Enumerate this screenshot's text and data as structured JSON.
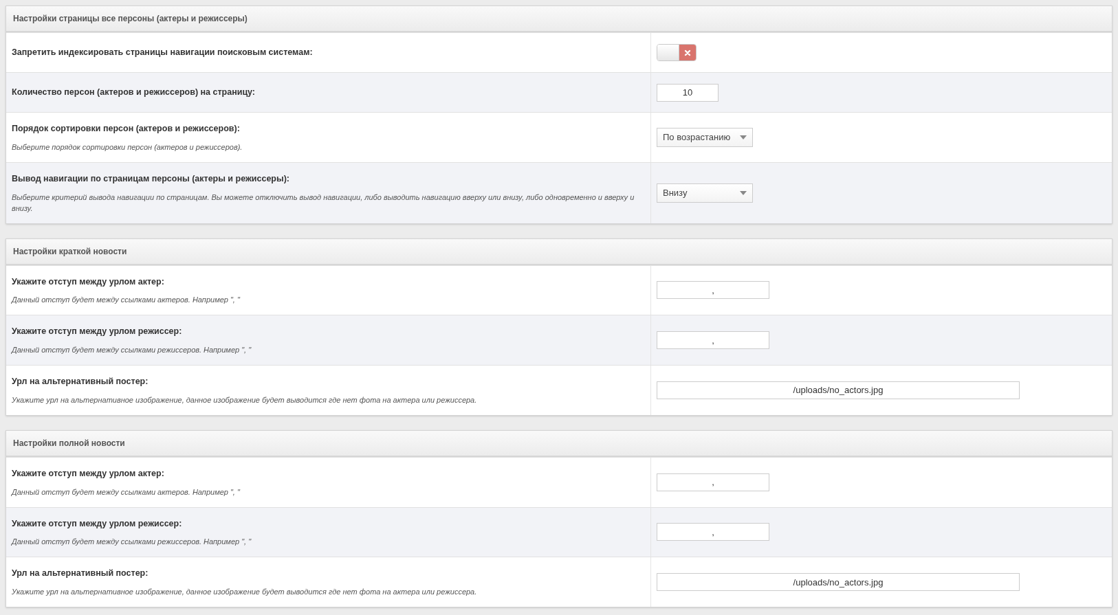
{
  "panels": [
    {
      "title": "Настройки страницы все персоны (актеры и режиссеры)",
      "rows": [
        {
          "kind": "toggle",
          "label": "Запретить индексировать страницы навигации поисковым системам:",
          "on": false
        },
        {
          "kind": "number",
          "label": "Количество персон (актеров и режиссеров) на страницу:",
          "value": "10"
        },
        {
          "kind": "select",
          "label": "Порядок сортировки персон (актеров и режиссеров):",
          "description": "Выберите порядок сортировки персон (актеров и режиссеров).",
          "value": "По возрастанию"
        },
        {
          "kind": "select",
          "label": "Вывод навигации по страницам персоны (актеры и режиссеры):",
          "description": "Выберите критерий вывода навигации по страницам. Вы можете отключить вывод навигации, либо выводить навигацию вверху или внизу, либо одновременно и вверху и внизу.",
          "value": "Внизу"
        }
      ]
    },
    {
      "title": "Настройки краткой новости",
      "rows": [
        {
          "kind": "text",
          "label": "Укажите отступ между урлом актер:",
          "description": "Данный отступ будет между ссылками актеров. Например \", \"",
          "value": ","
        },
        {
          "kind": "text",
          "label": "Укажите отступ между урлом режиссер:",
          "description": "Данный отступ будет между ссылками режиссеров. Например \", \"",
          "value": ","
        },
        {
          "kind": "url",
          "label": "Урл на альтернативный постер:",
          "description": "Укажите урл на альтернативное изображение, данное изображение будет выводится где нет фота на актера или режиссера.",
          "value": "/uploads/no_actors.jpg"
        }
      ]
    },
    {
      "title": "Настройки полной новости",
      "rows": [
        {
          "kind": "text",
          "label": "Укажите отступ между урлом актер:",
          "description": "Данный отступ будет между ссылками актеров. Например \", \"",
          "value": ","
        },
        {
          "kind": "text",
          "label": "Укажите отступ между урлом режиссер:",
          "description": "Данный отступ будет между ссылками режиссеров. Например \", \"",
          "value": ","
        },
        {
          "kind": "url",
          "label": "Урл на альтернативный постер:",
          "description": "Укажите урл на альтернативное изображение, данное изображение будет выводится где нет фота на актера или режиссера.",
          "value": "/uploads/no_actors.jpg"
        }
      ]
    }
  ]
}
